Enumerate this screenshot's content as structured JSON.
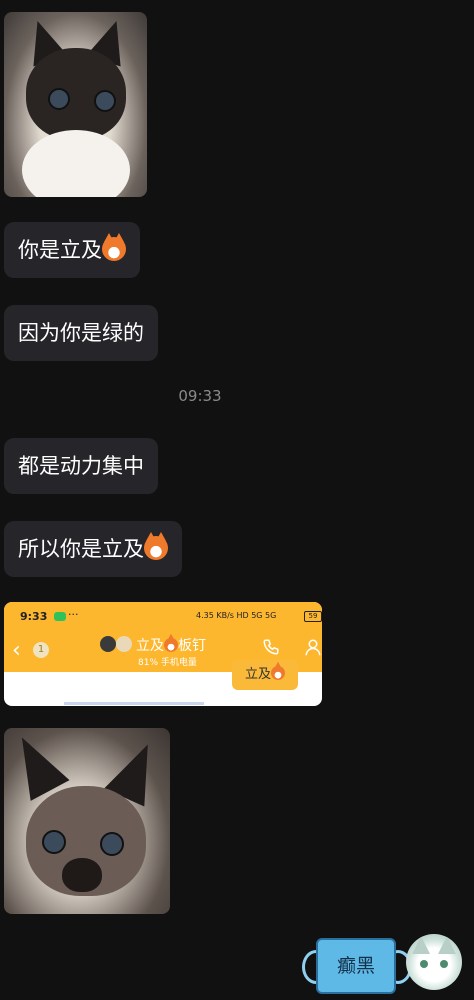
{
  "messages": [
    {
      "type": "image",
      "content": "cat-photo"
    },
    {
      "type": "text",
      "text": "你是立及",
      "emoji": "fox-emoji"
    },
    {
      "type": "text",
      "text": "因为你是绿的"
    },
    {
      "type": "timestamp",
      "text": "09:33"
    },
    {
      "type": "text",
      "text": "都是动力集中"
    },
    {
      "type": "text",
      "text": "所以你是立及",
      "emoji": "fox-emoji"
    },
    {
      "type": "image",
      "content": "chat-screenshot"
    },
    {
      "type": "image",
      "content": "cat-photo"
    }
  ],
  "screenshot": {
    "time": "9:33",
    "dots": "···",
    "network_speed": "4.35 KB/s",
    "signal": "HD 5G 5G",
    "battery": "59",
    "back_badge": "1",
    "group_title": "立及",
    "group_title_suffix": "板钉",
    "battery_status": "81% 手机电量",
    "bubble_text": "立及"
  },
  "sticker": {
    "text": "癫黑"
  },
  "colors": {
    "background": "#111111",
    "bubble": "#25252a",
    "screenshot_bar": "#fdb72f"
  }
}
